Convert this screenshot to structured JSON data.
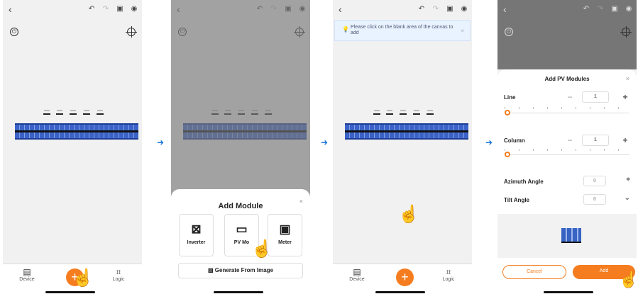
{
  "screens": [
    {
      "nav": {
        "device": "Device",
        "logic": "Logic"
      }
    },
    {
      "sheet": {
        "title": "Add Module",
        "items": [
          "Inverter",
          "PV Mo",
          "Meter"
        ],
        "generate": "Generate From Image"
      }
    },
    {
      "notice": "Please click on the blank area of the canvas to add",
      "nav": {
        "device": "Device",
        "logic": "Logic"
      }
    },
    {
      "dialog": {
        "title": "Add PV Modules",
        "line_label": "Line",
        "line_value": "1",
        "column_label": "Column",
        "column_value": "1",
        "azimuth_label": "Azimuth Angle",
        "azimuth_value": "0",
        "tilt_label": "Tilt Angle",
        "tilt_value": "0",
        "cancel": "Cancel",
        "add": "Add"
      }
    }
  ],
  "accent_color": "#f57d1f",
  "arrow_color": "#1b77d8"
}
